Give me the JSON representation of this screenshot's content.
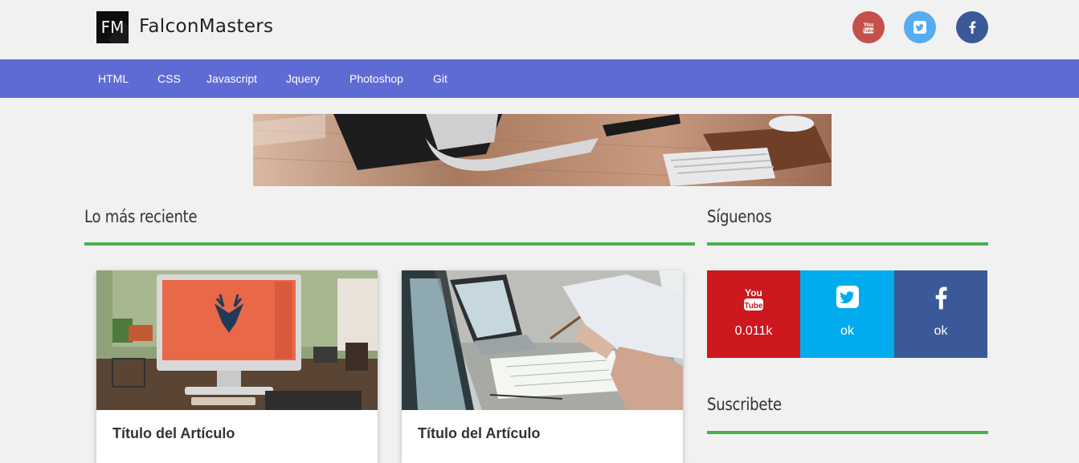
{
  "brand": {
    "logo_text": "FM",
    "name": "FalconMasters"
  },
  "social_top": [
    {
      "name": "youtube-icon",
      "color": "#c4504c"
    },
    {
      "name": "twitter-icon",
      "color": "#55acee"
    },
    {
      "name": "facebook-icon",
      "color": "#3b5998"
    }
  ],
  "nav": {
    "items": [
      "HTML",
      "CSS",
      "Javascript",
      "Jquery",
      "Photoshop",
      "Git"
    ]
  },
  "main": {
    "title": "Lo más reciente",
    "cards": [
      {
        "title": "Título del Artículo"
      },
      {
        "title": "Título del Artículo"
      }
    ]
  },
  "sidebar": {
    "follow_title": "Síguenos",
    "follow": [
      {
        "network": "youtube",
        "icon_text": "You Tube",
        "count": "0.011k",
        "color": "#cc181e"
      },
      {
        "network": "twitter",
        "count": "ok",
        "color": "#00acee"
      },
      {
        "network": "facebook",
        "count": "ok",
        "color": "#3b5998"
      }
    ],
    "subscribe_title": "Suscribete"
  },
  "colors": {
    "accent_nav": "#5f6bd4",
    "section_rule": "#4caf50",
    "background": "#f1f1f1"
  }
}
